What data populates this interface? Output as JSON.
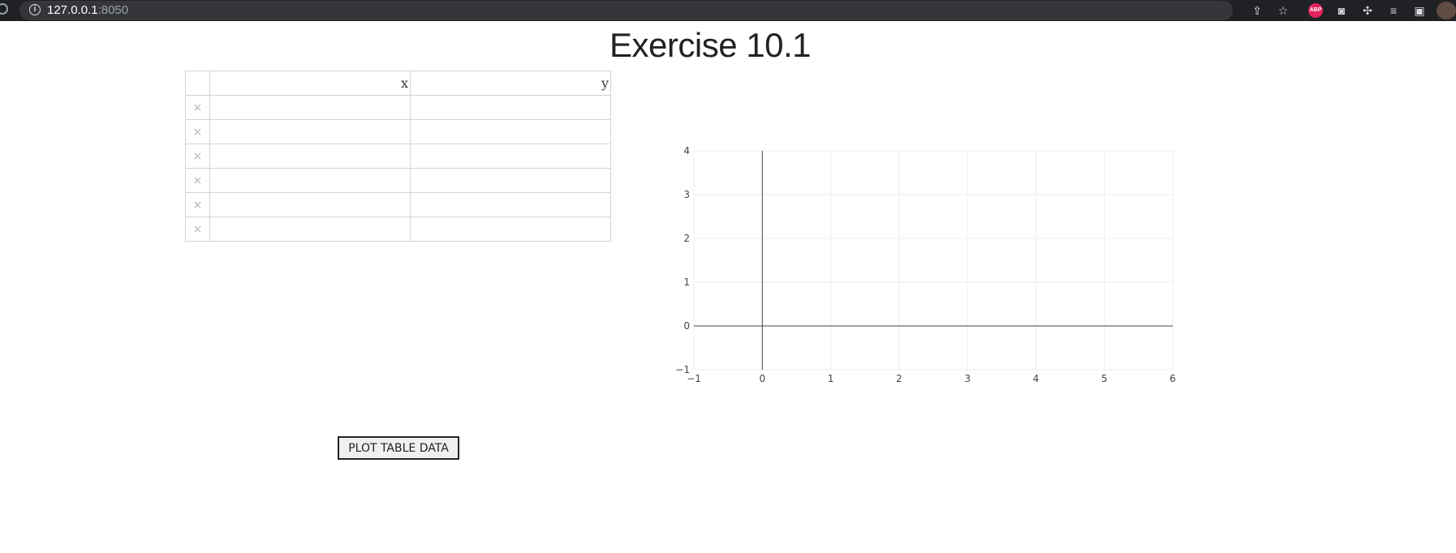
{
  "browser": {
    "url_host": "127.0.0.1",
    "url_port": ":8050",
    "extension_abp_label": "ABP"
  },
  "page": {
    "title": "Exercise 10.1"
  },
  "table": {
    "columns": [
      "x",
      "y"
    ],
    "rows": [
      {
        "x": "",
        "y": ""
      },
      {
        "x": "",
        "y": ""
      },
      {
        "x": "",
        "y": ""
      },
      {
        "x": "",
        "y": ""
      },
      {
        "x": "",
        "y": ""
      },
      {
        "x": "",
        "y": ""
      }
    ],
    "delete_glyph": "×"
  },
  "button": {
    "label": "PLOT TABLE DATA"
  },
  "chart_data": {
    "type": "scatter",
    "series": [],
    "xlim": [
      -1,
      6
    ],
    "ylim": [
      -1,
      4
    ],
    "x_ticks": [
      -1,
      0,
      1,
      2,
      3,
      4,
      5,
      6
    ],
    "y_ticks": [
      -1,
      0,
      1,
      2,
      3,
      4
    ],
    "x_tick_labels": [
      "−1",
      "0",
      "1",
      "2",
      "3",
      "4",
      "5",
      "6"
    ],
    "y_tick_labels": [
      "−1",
      "0",
      "1",
      "2",
      "3",
      "4"
    ],
    "grid": true,
    "zeroline_color": "#444444",
    "grid_color": "#eeeeee"
  }
}
